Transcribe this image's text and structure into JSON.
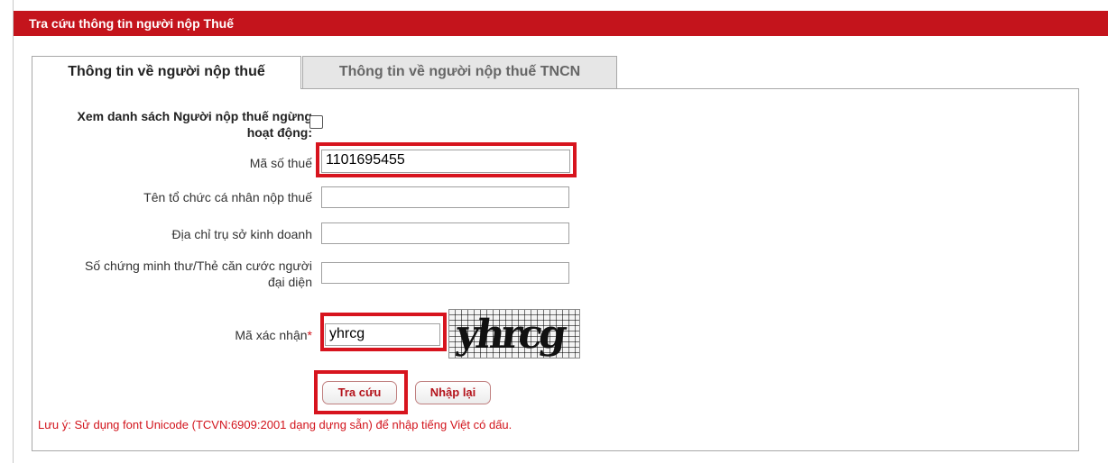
{
  "header": {
    "title": "Tra cứu thông tin người nộp Thuế"
  },
  "tabs": [
    {
      "label": "Thông tin về người nộp thuế",
      "active": true
    },
    {
      "label": "Thông tin về người nộp thuế TNCN",
      "active": false
    }
  ],
  "form": {
    "inactive_list_label_line1": "Xem danh sách Người nộp thuế ngừng",
    "inactive_list_label_line2": "hoạt động:",
    "tax_code_label": "Mã số thuế",
    "tax_code_value": "1101695455",
    "org_name_label": "Tên tổ chức cá nhân nộp thuế",
    "org_name_value": "",
    "address_label": "Địa chỉ trụ sở kinh doanh",
    "address_value": "",
    "id_label_line1": "Số chứng minh thư/Thẻ căn cước người",
    "id_label_line2": "đại diện",
    "id_value": "",
    "captcha_label": "Mã xác nhận",
    "captcha_required": "*",
    "captcha_value": "yhrcg",
    "captcha_image_text": "yhrcg"
  },
  "buttons": {
    "search": "Tra cứu",
    "reset": "Nhập lại"
  },
  "note": "Lưu ý: Sử dụng font Unicode (TCVN:6909:2001 dạng dựng sẵn) để nhập tiếng Việt có dấu.",
  "colors": {
    "accent": "#c4141c",
    "highlight": "#d7141e"
  }
}
